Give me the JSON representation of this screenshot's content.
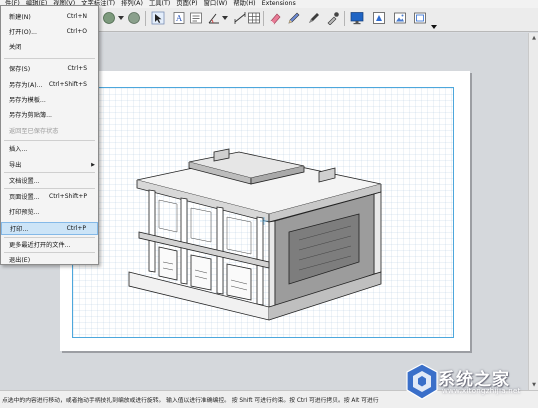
{
  "menubar": {
    "items": [
      {
        "label": "件(F)"
      },
      {
        "label": "编辑(E)"
      },
      {
        "label": "视图(V)"
      },
      {
        "label": "文字标注(T)"
      },
      {
        "label": "排列(A)"
      },
      {
        "label": "工具(T)"
      },
      {
        "label": "页面(P)"
      },
      {
        "label": "窗口(W)"
      },
      {
        "label": "帮助(H)"
      },
      {
        "label": "Extensions"
      }
    ]
  },
  "toolbar": {
    "icons": [
      "shapes-icon",
      "color-circle-icon",
      "dropdown-arrow-icon",
      "circle-tool-icon",
      "select-icon",
      "text-icon",
      "text-box-icon",
      "angle-tool-icon",
      "dimension-tool-icon",
      "table-icon",
      "eraser-icon",
      "pencil-icon",
      "pen-icon",
      "eyedropper-icon",
      "monitor-icon",
      "add-model-icon",
      "image-icon",
      "image-frame-icon",
      "more-dropdown-icon"
    ]
  },
  "file_menu": {
    "items": [
      {
        "label": "新建(N)",
        "shortcut": "Ctrl+N",
        "enabled": true
      },
      {
        "label": "打开(O)...",
        "shortcut": "Ctrl+O",
        "enabled": true
      },
      {
        "label": "关闭",
        "shortcut": "",
        "enabled": true
      },
      {
        "label": "保存(S)",
        "shortcut": "Ctrl+S",
        "enabled": true
      },
      {
        "label": "另存为(A)...",
        "shortcut": "Ctrl+Shift+S",
        "enabled": true
      },
      {
        "label": "另存为模板...",
        "shortcut": "",
        "enabled": true
      },
      {
        "label": "另存为剪贴簿...",
        "shortcut": "",
        "enabled": true
      },
      {
        "label": "返回至已保存状态",
        "shortcut": "",
        "enabled": false
      },
      {
        "label": "插入...",
        "shortcut": "",
        "enabled": true
      },
      {
        "label": "导出",
        "shortcut": "",
        "enabled": true,
        "submenu": true
      },
      {
        "label": "文档设置...",
        "shortcut": "",
        "enabled": true
      },
      {
        "label": "页面设置...",
        "shortcut": "Ctrl+Shift+P",
        "enabled": true
      },
      {
        "label": "打印预览...",
        "shortcut": "",
        "enabled": true
      },
      {
        "label": "打印...",
        "shortcut": "Ctrl+P",
        "enabled": true,
        "highlighted": true
      },
      {
        "label": "更多最近打开的文件...",
        "shortcut": "",
        "enabled": true
      },
      {
        "label": "退出(E)",
        "shortcut": "",
        "enabled": true
      }
    ]
  },
  "statusbar": {
    "text": "点选中的内容进行移动，或者拖动手柄技扎到编放或进行旋转。 输入值以进行准确编控。 按 Shift 可进行约束。按 Ctrl 可进行拷贝。按 Alt 可进行"
  },
  "watermark": {
    "text": "系统之家",
    "url": "www.xitongzhijia.net"
  },
  "colors": {
    "print_area_border": "#4da7dc",
    "menu_highlight": "#cce4f7",
    "watermark_blue": "#3a6fc9"
  }
}
